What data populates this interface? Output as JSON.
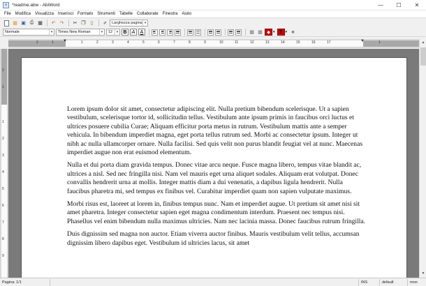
{
  "window": {
    "title": "*readme.abw - AbiWord",
    "minimize": "—",
    "maximize": "☐",
    "close": "✕"
  },
  "menu": [
    "File",
    "Modifica",
    "Visualizza",
    "Inserisci",
    "Formato",
    "Strumenti",
    "Tabelle",
    "Collaborate",
    "Finestra",
    "Aiuto"
  ],
  "toolbar": {
    "zoom_value": "Larghezza pagina"
  },
  "format_bar": {
    "style": "Normale",
    "font": "Times New Roman",
    "size": "12",
    "bold": "B",
    "italic": "A",
    "underline": "A",
    "text_color": "T"
  },
  "ruler": {
    "h_numbers": [
      "2",
      "1",
      "1",
      "2",
      "3",
      "4",
      "5",
      "6",
      "7",
      "8",
      "9",
      "10",
      "11",
      "12",
      "13",
      "14",
      "15",
      "16",
      "17",
      "1"
    ],
    "v_numbers": [
      "2",
      "1",
      "1",
      "2",
      "3",
      "4",
      "5",
      "6",
      "7",
      "8",
      "9"
    ]
  },
  "document": {
    "paragraphs": [
      "Lorem ipsum dolor sit amet, consectetur adipiscing elit. Nulla pretium bibendum scelerisque. Ut a sapien vestibulum, scelerisque tortor id, sollicitudin tellus. Vestibulum ante ipsum primis in faucibus orci luctus et ultrices posuere cubilia Curae; Aliquam efficitur porta metus in rutrum. Vestibulum mattis ante a semper vehicula. In bibendum imperdiet magna, eget porta tellus rutrum sed. Morbi ac consectetur ipsum. Integer ut nibh ac nulla ullamcorper ornare. Nulla facilisi. Sed quis velit non purus blandit feugiat vel at nunc. Maecenas imperdiet augue non erat euismod elementum.",
      "Nulla et dui porta diam gravida tempus. Donec vitae arcu neque. Fusce magna libero, tempus vitae blandit ac, ultrices a nisl. Sed nec fringilla nisi. Nam vel mauris eget urna aliquet sodales. Aliquam erat volutpat. Donec convallis hendrerit urna at mollis. Integer mattis diam a dui venenatis, a dapibus ligula hendrerit. Nulla faucibus pharetra mi, sed tempus ex finibus vel. Curabitur imperdiet quam non sapien vulputate maximus.",
      "Morbi risus est, laoreet at lorem in, finibus tempus nunc. Nam et imperdiet augue. Ut pretium sit amet nisi sit amet pharetra. Integer consectetur sapien eget magna condimentum interdum. Praesent nec tempus nisi. Phasellus vel enim bibendum nulla maximus ultricies. Nam nec lacinia massa. Donec faucibus rutrum fringilla.",
      "Duis dignissim sed magna non auctor. Etiam viverra auctor finibus. Mauris vestibulum velit tellus, accumsan dignissim libero dapibus eget. Vestibulum id ultricies lacus, sit amet"
    ]
  },
  "status": {
    "page": "Pagina: 1/1",
    "mode": "INS",
    "lang_style": "default",
    "locale": "mon"
  },
  "colors": {
    "canvas": "#7a7a7a",
    "highlight": "#cc0000",
    "text_color": "#cc0000"
  }
}
